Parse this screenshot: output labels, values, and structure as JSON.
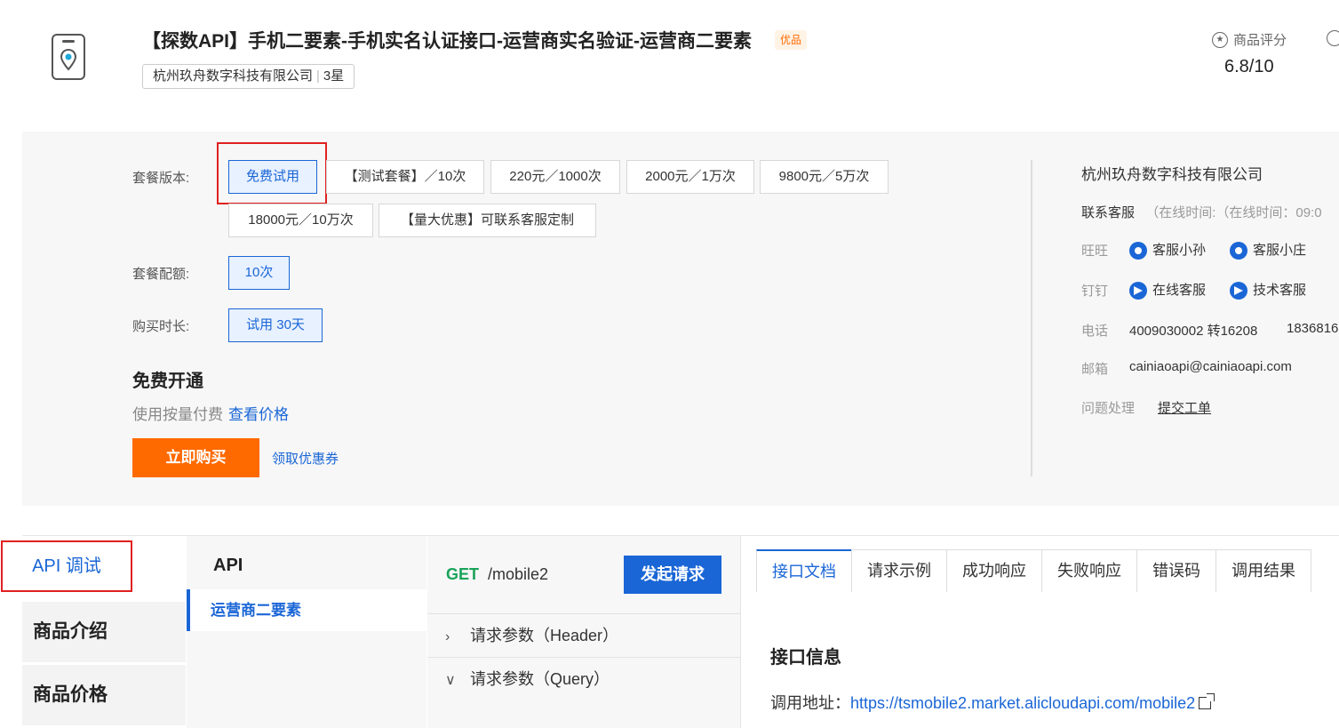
{
  "header": {
    "title": "【探数API】手机二要素-手机实名认证接口-运营商实名验证-运营商二要素",
    "badge": "优品",
    "company": "杭州玖舟数字科技有限公司",
    "stars": "3星",
    "rating_label": "商品评分",
    "rating_value": "6.8/10"
  },
  "package": {
    "version_label": "套餐版本:",
    "versions": [
      "免费试用",
      "【测试套餐】／10次",
      "220元／1000次",
      "2000元／1万次",
      "9800元／5万次",
      "18000元／10万次",
      "【量大优惠】可联系客服定制"
    ],
    "quota_label": "套餐配额:",
    "quota": "10次",
    "duration_label": "购买时长:",
    "duration": "试用 30天",
    "free_title": "免费开通",
    "pay_text": "使用按量付费",
    "pay_link": "查看价格",
    "buy_button": "立即购买",
    "coupon": "领取优惠券"
  },
  "seller": {
    "company": "杭州玖舟数字科技有限公司",
    "contact_label": "联系客服",
    "contact_hours": "（在线时间:（在线时间：09:0",
    "wangwang_label": "旺旺",
    "wangwang_1": "客服小孙",
    "wangwang_2": "客服小庄",
    "dingding_label": "钉钉",
    "dingding_1": "在线客服",
    "dingding_2": "技术客服",
    "phone_label": "电话",
    "phone_1": "4009030002 转16208",
    "phone_2": "1836816",
    "email_label": "邮箱",
    "email": "cainiaoapi@cainiaoapi.com",
    "issue_label": "问题处理",
    "issue_link": "提交工单"
  },
  "nav": {
    "api_debug": "API 调试",
    "intro": "商品介绍",
    "price": "商品价格"
  },
  "api": {
    "heading": "API",
    "item": "运营商二要素",
    "method": "GET",
    "path": "/mobile2",
    "send": "发起请求",
    "header_params": "请求参数（Header）",
    "query_params": "请求参数（Query）"
  },
  "docs": {
    "tabs": [
      "接口文档",
      "请求示例",
      "成功响应",
      "失败响应",
      "错误码",
      "调用结果"
    ],
    "title": "接口信息",
    "addr_label": "调用地址：",
    "addr_url": "https://tsmobile2.market.alicloudapi.com/mobile2"
  }
}
